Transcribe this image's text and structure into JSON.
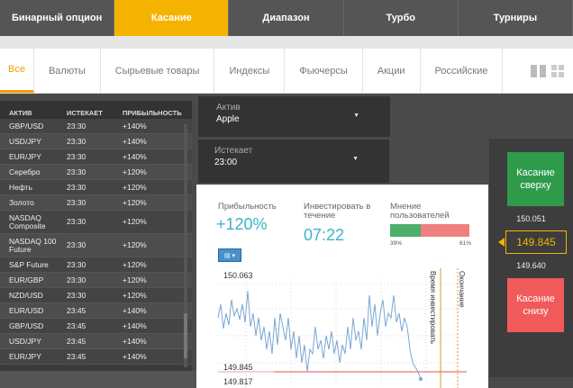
{
  "topnav": [
    {
      "label": "Бинарный опцион",
      "active": false
    },
    {
      "label": "Касание",
      "active": true
    },
    {
      "label": "Диапазон",
      "active": false
    },
    {
      "label": "Турбо",
      "active": false
    },
    {
      "label": "Турниры",
      "active": false
    }
  ],
  "categories": [
    "Все",
    "Валюты",
    "Сырьевые товары",
    "Индексы",
    "Фьючерсы",
    "Акции",
    "Российские"
  ],
  "table": {
    "headers": [
      "АКТИВ",
      "ИСТЕКАЕТ",
      "ПРИБЫЛЬНОСТЬ"
    ],
    "rows": [
      [
        "GBP/USD",
        "23:30",
        "+140%"
      ],
      [
        "USD/JPY",
        "23:30",
        "+140%"
      ],
      [
        "EUR/JPY",
        "23:30",
        "+140%"
      ],
      [
        "Серебро",
        "23:30",
        "+120%"
      ],
      [
        "Нефть",
        "23:30",
        "+120%"
      ],
      [
        "Золото",
        "23:30",
        "+120%"
      ],
      [
        "NASDAQ Composite",
        "23:30",
        "+120%"
      ],
      [
        "NASDAQ 100 Future",
        "23:30",
        "+120%"
      ],
      [
        "S&P Future",
        "23:30",
        "+120%"
      ],
      [
        "EUR/GBP",
        "23:30",
        "+120%"
      ],
      [
        "NZD/USD",
        "23:30",
        "+120%"
      ],
      [
        "EUR/USD",
        "23:45",
        "+140%"
      ],
      [
        "GBP/USD",
        "23:45",
        "+140%"
      ],
      [
        "USD/JPY",
        "23:45",
        "+140%"
      ],
      [
        "EUR/JPY",
        "23:45",
        "+140%"
      ]
    ]
  },
  "asset_selector": {
    "label": "Актив",
    "value": "Apple"
  },
  "expiry_selector": {
    "label": "Истекает",
    "value": "23:00"
  },
  "stats": {
    "profit_label": "Прибыльность",
    "profit_value": "+120%",
    "invest_label": "Инвестировать в течение",
    "invest_value": "07:22",
    "opinion_label": "Мнение пользователей",
    "opinion_green": "39%",
    "opinion_red": "61%"
  },
  "chart": {
    "top_price": "150.063",
    "target_low": "149.845",
    "bottom_price": "149.817",
    "invest_time_label": "Время инвестировать",
    "expiry_label": "Окончание"
  },
  "right": {
    "up_label": "Касание сверху",
    "up_price": "150.051",
    "current": "149.845",
    "down_price": "149.640",
    "down_label": "Касание снизу"
  },
  "colors": {
    "accent": "#f5b301",
    "up": "#2e9b4b",
    "down": "#f05a5a",
    "teal": "#3cb4c8"
  }
}
